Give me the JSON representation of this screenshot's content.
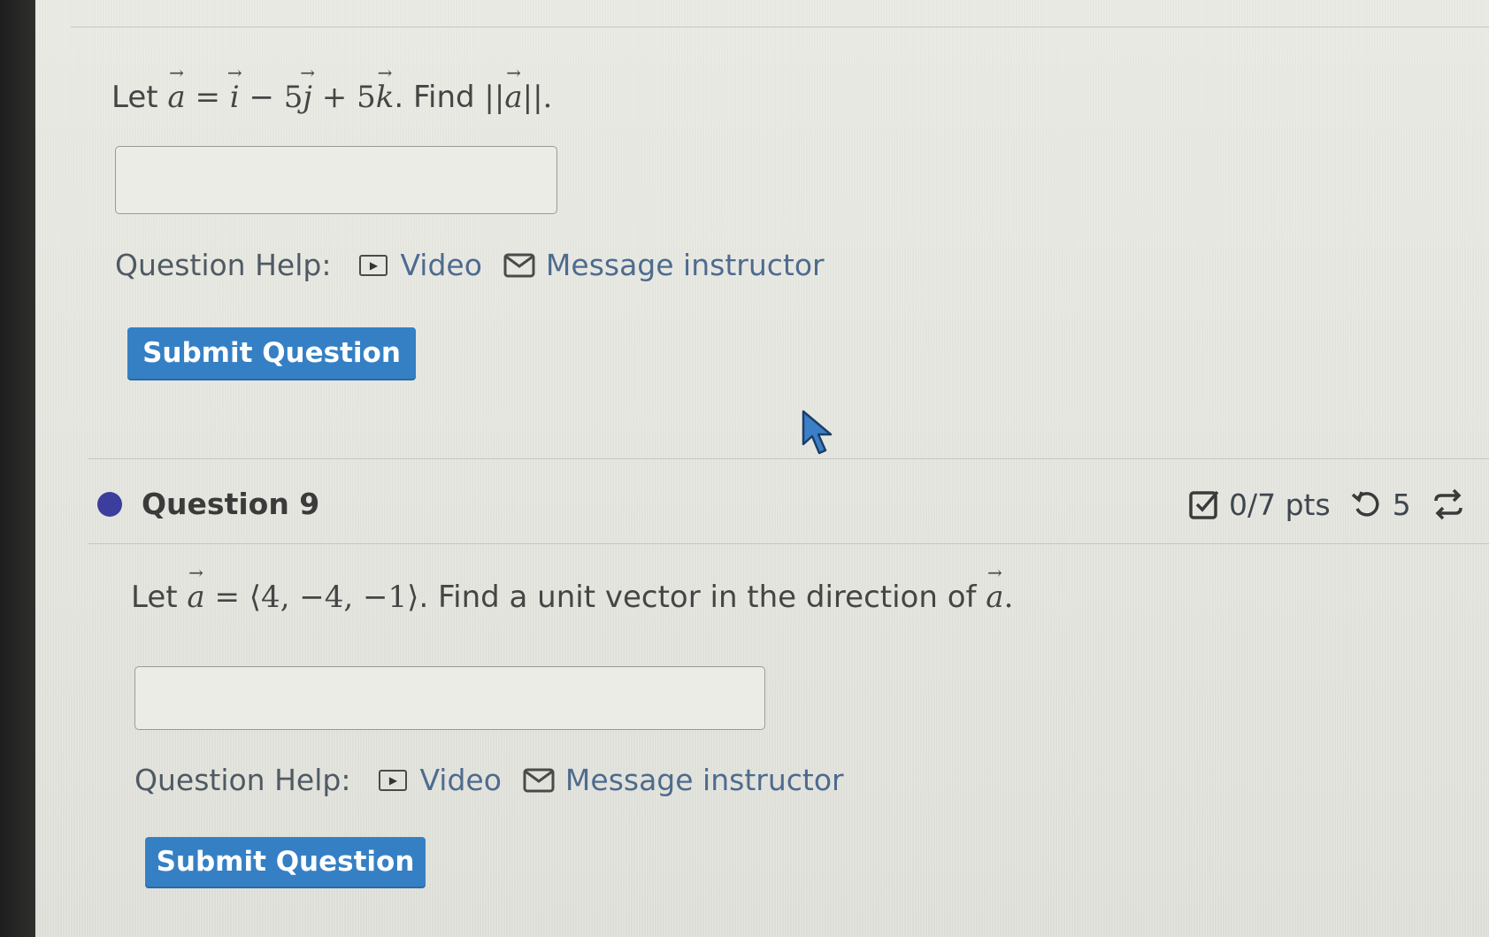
{
  "question8": {
    "prompt_pre": "Let",
    "prompt_find": ". Find",
    "help_label": "Question Help:",
    "video_label": "Video",
    "message_label": "Message instructor",
    "submit_label": "Submit Question"
  },
  "question9": {
    "title": "Question 9",
    "points": "0/7 pts",
    "attempts": "5",
    "prompt_pre": "Let",
    "prompt_post": ". Find a unit vector in the direction of",
    "help_label": "Question Help:",
    "video_label": "Video",
    "message_label": "Message instructor",
    "submit_label": "Submit Question"
  },
  "icons": {
    "video": "video-icon",
    "message": "mail-icon",
    "points": "checkbox-icon",
    "retry": "retry-icon",
    "regenerate": "regenerate-icon",
    "status": "status-dot-icon"
  },
  "colors": {
    "button": "#3580c4",
    "link": "#4d6b8e",
    "status_dot": "#3b3e9c"
  }
}
